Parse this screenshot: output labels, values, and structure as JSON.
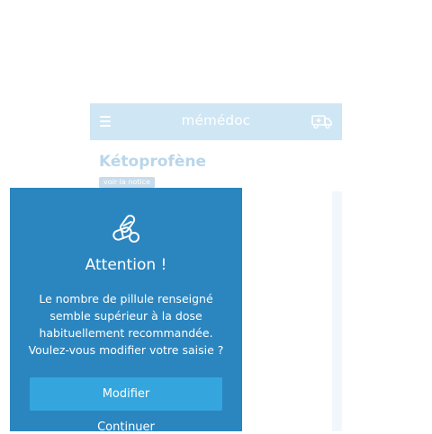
{
  "header": {
    "brand": "mémédoc",
    "menu_icon": "hamburger-menu-icon",
    "right_icon": "ambulance-icon"
  },
  "drug": {
    "title": "Kétoprofène",
    "notice_label": "voir la notice"
  },
  "alert": {
    "icon": "pills-icon",
    "title": "Attention !",
    "line1": "Le nombre de pillule renseigné",
    "line2": "semble supérieur à la dose",
    "line3": "habituellement recommandée.",
    "line4": "Voulez-vous modifier votre saisie ?",
    "primary_label": "Modifier",
    "secondary_label": "Continuer"
  },
  "colors": {
    "header_bg": "#cfe6f5",
    "modal_bg": "#2b86c0",
    "button_bg": "#34a6dd"
  }
}
